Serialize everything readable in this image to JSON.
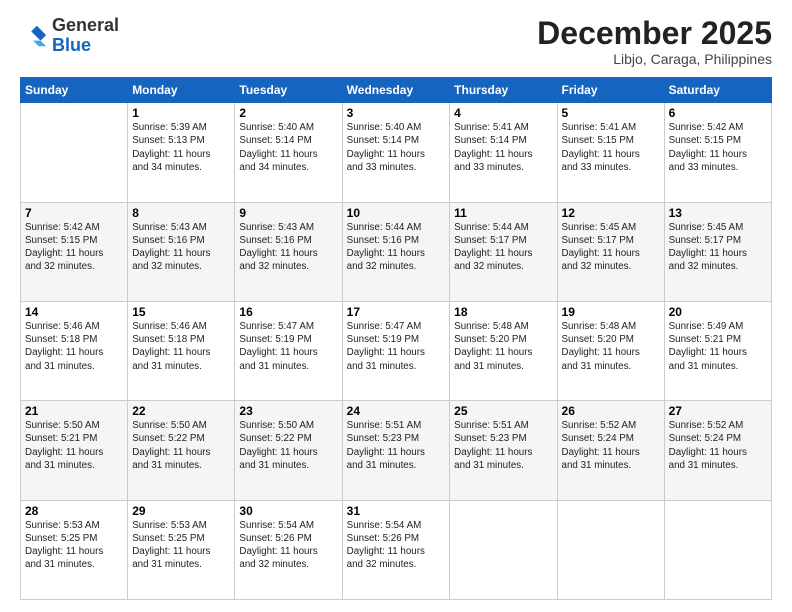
{
  "header": {
    "logo_general": "General",
    "logo_blue": "Blue",
    "month_title": "December 2025",
    "location": "Libjo, Caraga, Philippines"
  },
  "days_of_week": [
    "Sunday",
    "Monday",
    "Tuesday",
    "Wednesday",
    "Thursday",
    "Friday",
    "Saturday"
  ],
  "weeks": [
    [
      {
        "day": "",
        "info": ""
      },
      {
        "day": "1",
        "info": "Sunrise: 5:39 AM\nSunset: 5:13 PM\nDaylight: 11 hours\nand 34 minutes."
      },
      {
        "day": "2",
        "info": "Sunrise: 5:40 AM\nSunset: 5:14 PM\nDaylight: 11 hours\nand 34 minutes."
      },
      {
        "day": "3",
        "info": "Sunrise: 5:40 AM\nSunset: 5:14 PM\nDaylight: 11 hours\nand 33 minutes."
      },
      {
        "day": "4",
        "info": "Sunrise: 5:41 AM\nSunset: 5:14 PM\nDaylight: 11 hours\nand 33 minutes."
      },
      {
        "day": "5",
        "info": "Sunrise: 5:41 AM\nSunset: 5:15 PM\nDaylight: 11 hours\nand 33 minutes."
      },
      {
        "day": "6",
        "info": "Sunrise: 5:42 AM\nSunset: 5:15 PM\nDaylight: 11 hours\nand 33 minutes."
      }
    ],
    [
      {
        "day": "7",
        "info": "Sunrise: 5:42 AM\nSunset: 5:15 PM\nDaylight: 11 hours\nand 32 minutes."
      },
      {
        "day": "8",
        "info": "Sunrise: 5:43 AM\nSunset: 5:16 PM\nDaylight: 11 hours\nand 32 minutes."
      },
      {
        "day": "9",
        "info": "Sunrise: 5:43 AM\nSunset: 5:16 PM\nDaylight: 11 hours\nand 32 minutes."
      },
      {
        "day": "10",
        "info": "Sunrise: 5:44 AM\nSunset: 5:16 PM\nDaylight: 11 hours\nand 32 minutes."
      },
      {
        "day": "11",
        "info": "Sunrise: 5:44 AM\nSunset: 5:17 PM\nDaylight: 11 hours\nand 32 minutes."
      },
      {
        "day": "12",
        "info": "Sunrise: 5:45 AM\nSunset: 5:17 PM\nDaylight: 11 hours\nand 32 minutes."
      },
      {
        "day": "13",
        "info": "Sunrise: 5:45 AM\nSunset: 5:17 PM\nDaylight: 11 hours\nand 32 minutes."
      }
    ],
    [
      {
        "day": "14",
        "info": "Sunrise: 5:46 AM\nSunset: 5:18 PM\nDaylight: 11 hours\nand 31 minutes."
      },
      {
        "day": "15",
        "info": "Sunrise: 5:46 AM\nSunset: 5:18 PM\nDaylight: 11 hours\nand 31 minutes."
      },
      {
        "day": "16",
        "info": "Sunrise: 5:47 AM\nSunset: 5:19 PM\nDaylight: 11 hours\nand 31 minutes."
      },
      {
        "day": "17",
        "info": "Sunrise: 5:47 AM\nSunset: 5:19 PM\nDaylight: 11 hours\nand 31 minutes."
      },
      {
        "day": "18",
        "info": "Sunrise: 5:48 AM\nSunset: 5:20 PM\nDaylight: 11 hours\nand 31 minutes."
      },
      {
        "day": "19",
        "info": "Sunrise: 5:48 AM\nSunset: 5:20 PM\nDaylight: 11 hours\nand 31 minutes."
      },
      {
        "day": "20",
        "info": "Sunrise: 5:49 AM\nSunset: 5:21 PM\nDaylight: 11 hours\nand 31 minutes."
      }
    ],
    [
      {
        "day": "21",
        "info": "Sunrise: 5:50 AM\nSunset: 5:21 PM\nDaylight: 11 hours\nand 31 minutes."
      },
      {
        "day": "22",
        "info": "Sunrise: 5:50 AM\nSunset: 5:22 PM\nDaylight: 11 hours\nand 31 minutes."
      },
      {
        "day": "23",
        "info": "Sunrise: 5:50 AM\nSunset: 5:22 PM\nDaylight: 11 hours\nand 31 minutes."
      },
      {
        "day": "24",
        "info": "Sunrise: 5:51 AM\nSunset: 5:23 PM\nDaylight: 11 hours\nand 31 minutes."
      },
      {
        "day": "25",
        "info": "Sunrise: 5:51 AM\nSunset: 5:23 PM\nDaylight: 11 hours\nand 31 minutes."
      },
      {
        "day": "26",
        "info": "Sunrise: 5:52 AM\nSunset: 5:24 PM\nDaylight: 11 hours\nand 31 minutes."
      },
      {
        "day": "27",
        "info": "Sunrise: 5:52 AM\nSunset: 5:24 PM\nDaylight: 11 hours\nand 31 minutes."
      }
    ],
    [
      {
        "day": "28",
        "info": "Sunrise: 5:53 AM\nSunset: 5:25 PM\nDaylight: 11 hours\nand 31 minutes."
      },
      {
        "day": "29",
        "info": "Sunrise: 5:53 AM\nSunset: 5:25 PM\nDaylight: 11 hours\nand 31 minutes."
      },
      {
        "day": "30",
        "info": "Sunrise: 5:54 AM\nSunset: 5:26 PM\nDaylight: 11 hours\nand 32 minutes."
      },
      {
        "day": "31",
        "info": "Sunrise: 5:54 AM\nSunset: 5:26 PM\nDaylight: 11 hours\nand 32 minutes."
      },
      {
        "day": "",
        "info": ""
      },
      {
        "day": "",
        "info": ""
      },
      {
        "day": "",
        "info": ""
      }
    ]
  ]
}
